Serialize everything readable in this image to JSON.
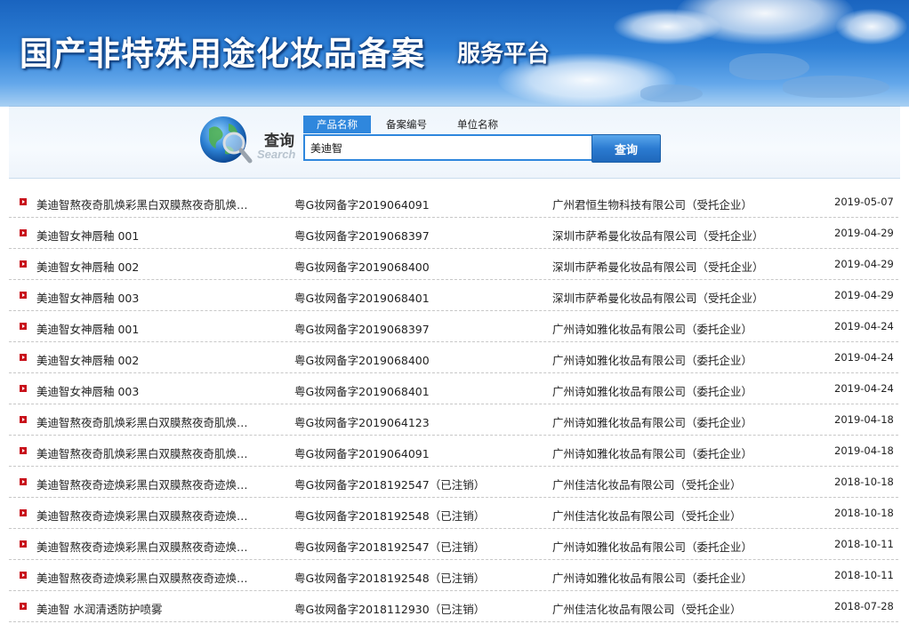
{
  "banner": {
    "title": "国产非特殊用途化妆品备案",
    "subtitle": "服务平台"
  },
  "search": {
    "label_cn": "查询",
    "label_en": "Search",
    "tabs": [
      {
        "label": "产品名称",
        "active": true
      },
      {
        "label": "备案编号",
        "active": false
      },
      {
        "label": "单位名称",
        "active": false
      }
    ],
    "query": "美迪智",
    "button_label": "查询"
  },
  "results": [
    {
      "name": "美迪智熬夜奇肌焕彩黑白双膜熬夜奇肌焕…",
      "code": "粤G妆网备字2019064091",
      "company": "广州君恒生物科技有限公司（受托企业）",
      "date": "2019-05-07"
    },
    {
      "name": "美迪智女神唇釉 001",
      "code": "粤G妆网备字2019068397",
      "company": "深圳市萨希曼化妆品有限公司（受托企业）",
      "date": "2019-04-29"
    },
    {
      "name": "美迪智女神唇釉 002",
      "code": "粤G妆网备字2019068400",
      "company": "深圳市萨希曼化妆品有限公司（受托企业）",
      "date": "2019-04-29"
    },
    {
      "name": "美迪智女神唇釉 003",
      "code": "粤G妆网备字2019068401",
      "company": "深圳市萨希曼化妆品有限公司（受托企业）",
      "date": "2019-04-29"
    },
    {
      "name": "美迪智女神唇釉 001",
      "code": "粤G妆网备字2019068397",
      "company": "广州诗如雅化妆品有限公司（委托企业）",
      "date": "2019-04-24"
    },
    {
      "name": "美迪智女神唇釉 002",
      "code": "粤G妆网备字2019068400",
      "company": "广州诗如雅化妆品有限公司（委托企业）",
      "date": "2019-04-24"
    },
    {
      "name": "美迪智女神唇釉 003",
      "code": "粤G妆网备字2019068401",
      "company": "广州诗如雅化妆品有限公司（委托企业）",
      "date": "2019-04-24"
    },
    {
      "name": "美迪智熬夜奇肌焕彩黑白双膜熬夜奇肌焕…",
      "code": "粤G妆网备字2019064123",
      "company": "广州诗如雅化妆品有限公司（委托企业）",
      "date": "2019-04-18"
    },
    {
      "name": "美迪智熬夜奇肌焕彩黑白双膜熬夜奇肌焕…",
      "code": "粤G妆网备字2019064091",
      "company": "广州诗如雅化妆品有限公司（委托企业）",
      "date": "2019-04-18"
    },
    {
      "name": "美迪智熬夜奇迹焕彩黑白双膜熬夜奇迹焕…",
      "code": "粤G妆网备字2018192547（已注销）",
      "company": "广州佳洁化妆品有限公司（受托企业）",
      "date": "2018-10-18"
    },
    {
      "name": "美迪智熬夜奇迹焕彩黑白双膜熬夜奇迹焕…",
      "code": "粤G妆网备字2018192548（已注销）",
      "company": "广州佳洁化妆品有限公司（受托企业）",
      "date": "2018-10-18"
    },
    {
      "name": "美迪智熬夜奇迹焕彩黑白双膜熬夜奇迹焕…",
      "code": "粤G妆网备字2018192547（已注销）",
      "company": "广州诗如雅化妆品有限公司（委托企业）",
      "date": "2018-10-11"
    },
    {
      "name": "美迪智熬夜奇迹焕彩黑白双膜熬夜奇迹焕…",
      "code": "粤G妆网备字2018192548（已注销）",
      "company": "广州诗如雅化妆品有限公司（委托企业）",
      "date": "2018-10-11"
    },
    {
      "name": "美迪智 水润清透防护喷雾",
      "code": "粤G妆网备字2018112930（已注销）",
      "company": "广州佳洁化妆品有限公司（受托企业）",
      "date": "2018-07-28"
    }
  ],
  "colors": {
    "accent_blue": "#2f87dd",
    "bullet_red": "#c8101a"
  },
  "icons": {
    "search_graphic": "globe-magnifier-icon",
    "row_bullet": "red-square-arrow-icon"
  }
}
